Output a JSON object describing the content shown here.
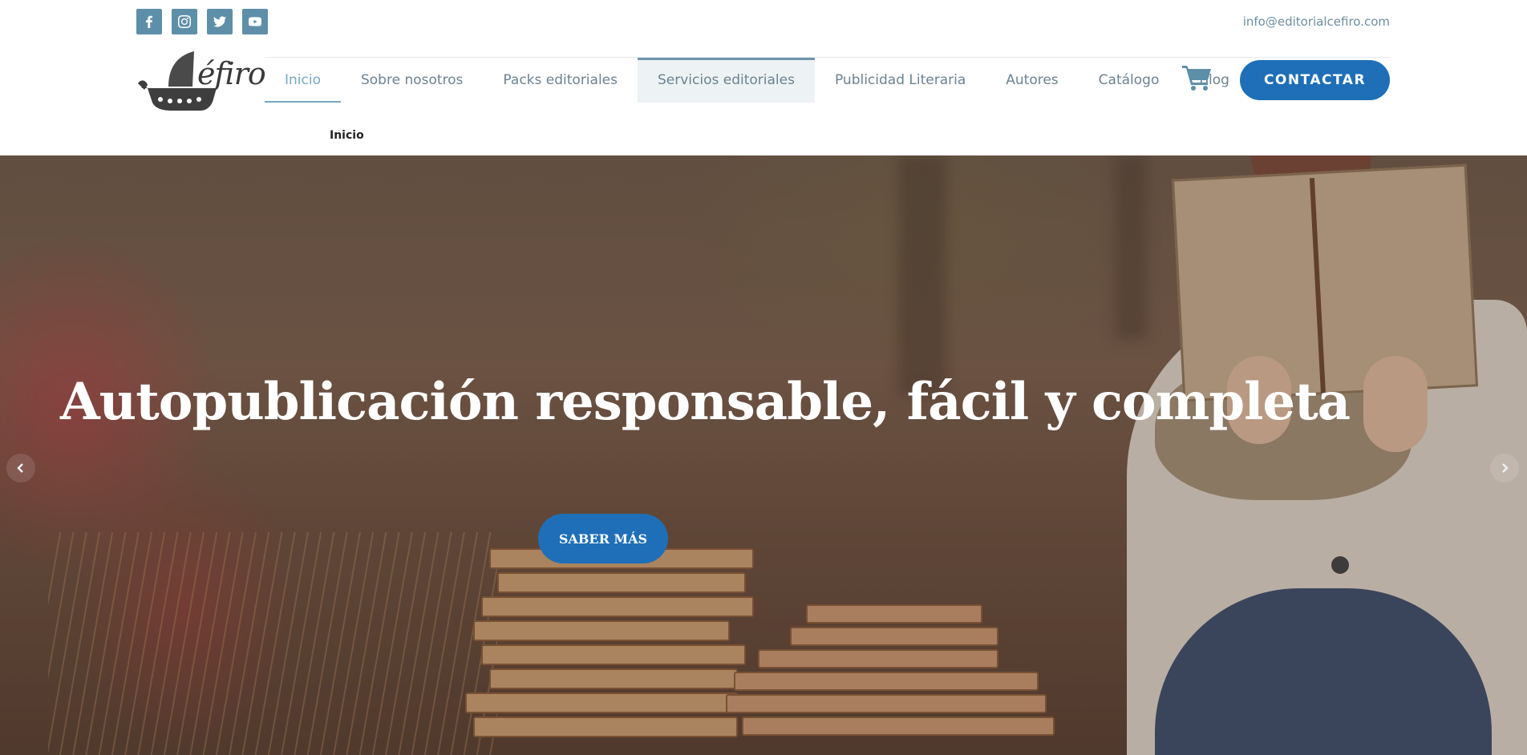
{
  "topbar": {
    "social": [
      {
        "name": "facebook-icon"
      },
      {
        "name": "instagram-icon"
      },
      {
        "name": "twitter-icon"
      },
      {
        "name": "youtube-icon"
      }
    ],
    "email": "info@editorialcefiro.com"
  },
  "logo": {
    "text": "éfiro"
  },
  "nav": {
    "items": [
      {
        "label": "Inicio",
        "state": "active"
      },
      {
        "label": "Sobre nosotros"
      },
      {
        "label": "Packs editoriales"
      },
      {
        "label": "Servicios editoriales",
        "state": "hovered"
      },
      {
        "label": "Publicidad Literaria"
      },
      {
        "label": "Autores"
      },
      {
        "label": "Catálogo"
      },
      {
        "label": "Blog"
      }
    ],
    "cart_icon": "shopping-cart-icon",
    "contact_label": "CONTACTAR"
  },
  "breadcrumb": "Inicio",
  "hero": {
    "title": "Autopublicación responsable, fácil y completa",
    "button_label": "SABER MÁS"
  },
  "colors": {
    "accent": "#1e6fb8",
    "social_bg": "#5e8fa9",
    "nav_text": "#6b8392",
    "nav_active": "#76a7c2"
  }
}
